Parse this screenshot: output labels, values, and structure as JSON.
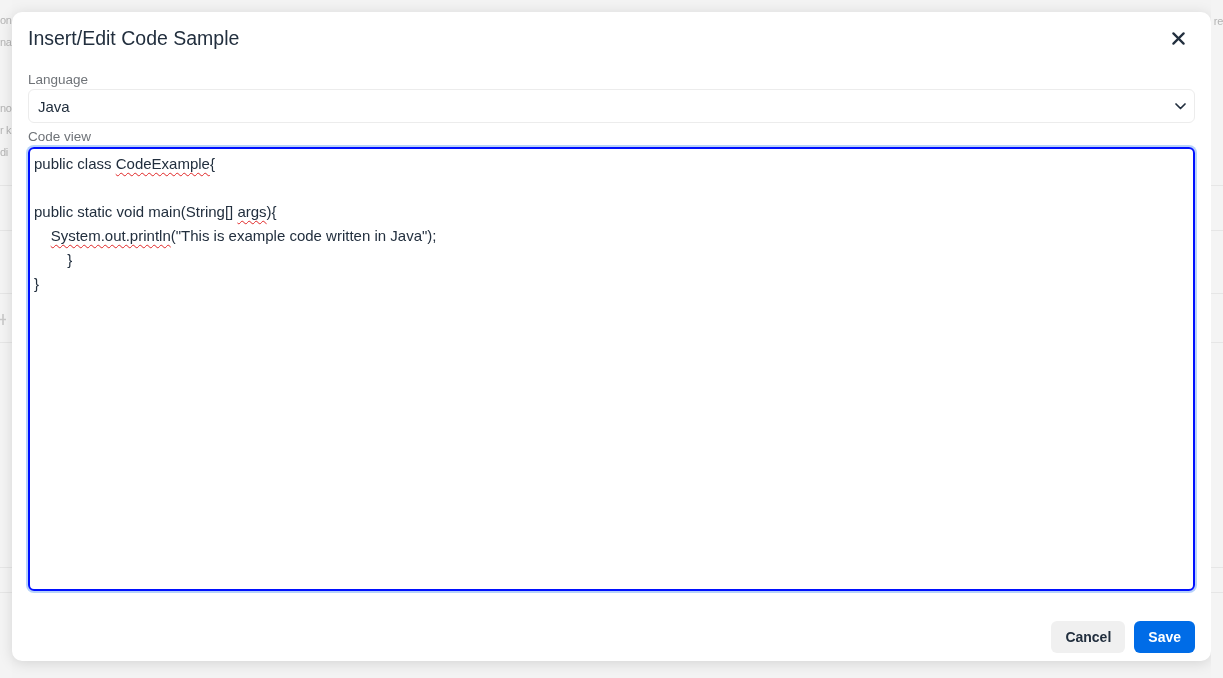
{
  "background": {
    "left_paragraphs": [
      {
        "lines": [
          "on",
          "na"
        ]
      },
      {
        "lines": [
          "no",
          "r k",
          "di"
        ]
      }
    ],
    "right_paragraphs": [
      {
        "lines": [
          "re"
        ]
      }
    ]
  },
  "dialog": {
    "title": "Insert/Edit Code Sample",
    "language": {
      "label": "Language",
      "value": "Java"
    },
    "code_view": {
      "label": "Code view",
      "focused": true,
      "lines": [
        {
          "kind": "code",
          "segments": [
            {
              "text": "public class ",
              "misspelled": false
            },
            {
              "text": "CodeExample",
              "misspelled": true
            },
            {
              "text": "{",
              "misspelled": false
            }
          ]
        },
        {
          "kind": "blank"
        },
        {
          "kind": "code",
          "segments": [
            {
              "text": "public static void main(String[] ",
              "misspelled": false
            },
            {
              "text": "args",
              "misspelled": true
            },
            {
              "text": "){",
              "misspelled": false
            }
          ]
        },
        {
          "kind": "code",
          "segments": [
            {
              "text": "    System.out.println",
              "misspelled": true
            },
            {
              "text": "(\"This is example code written in Java\");",
              "misspelled": false
            }
          ]
        },
        {
          "kind": "code",
          "segments": [
            {
              "text": "        }",
              "misspelled": false
            }
          ]
        },
        {
          "kind": "code",
          "segments": [
            {
              "text": "}",
              "misspelled": false
            }
          ]
        }
      ]
    },
    "buttons": [
      {
        "label": "Cancel",
        "kind": "secondary"
      },
      {
        "label": "Save",
        "kind": "primary"
      }
    ]
  }
}
